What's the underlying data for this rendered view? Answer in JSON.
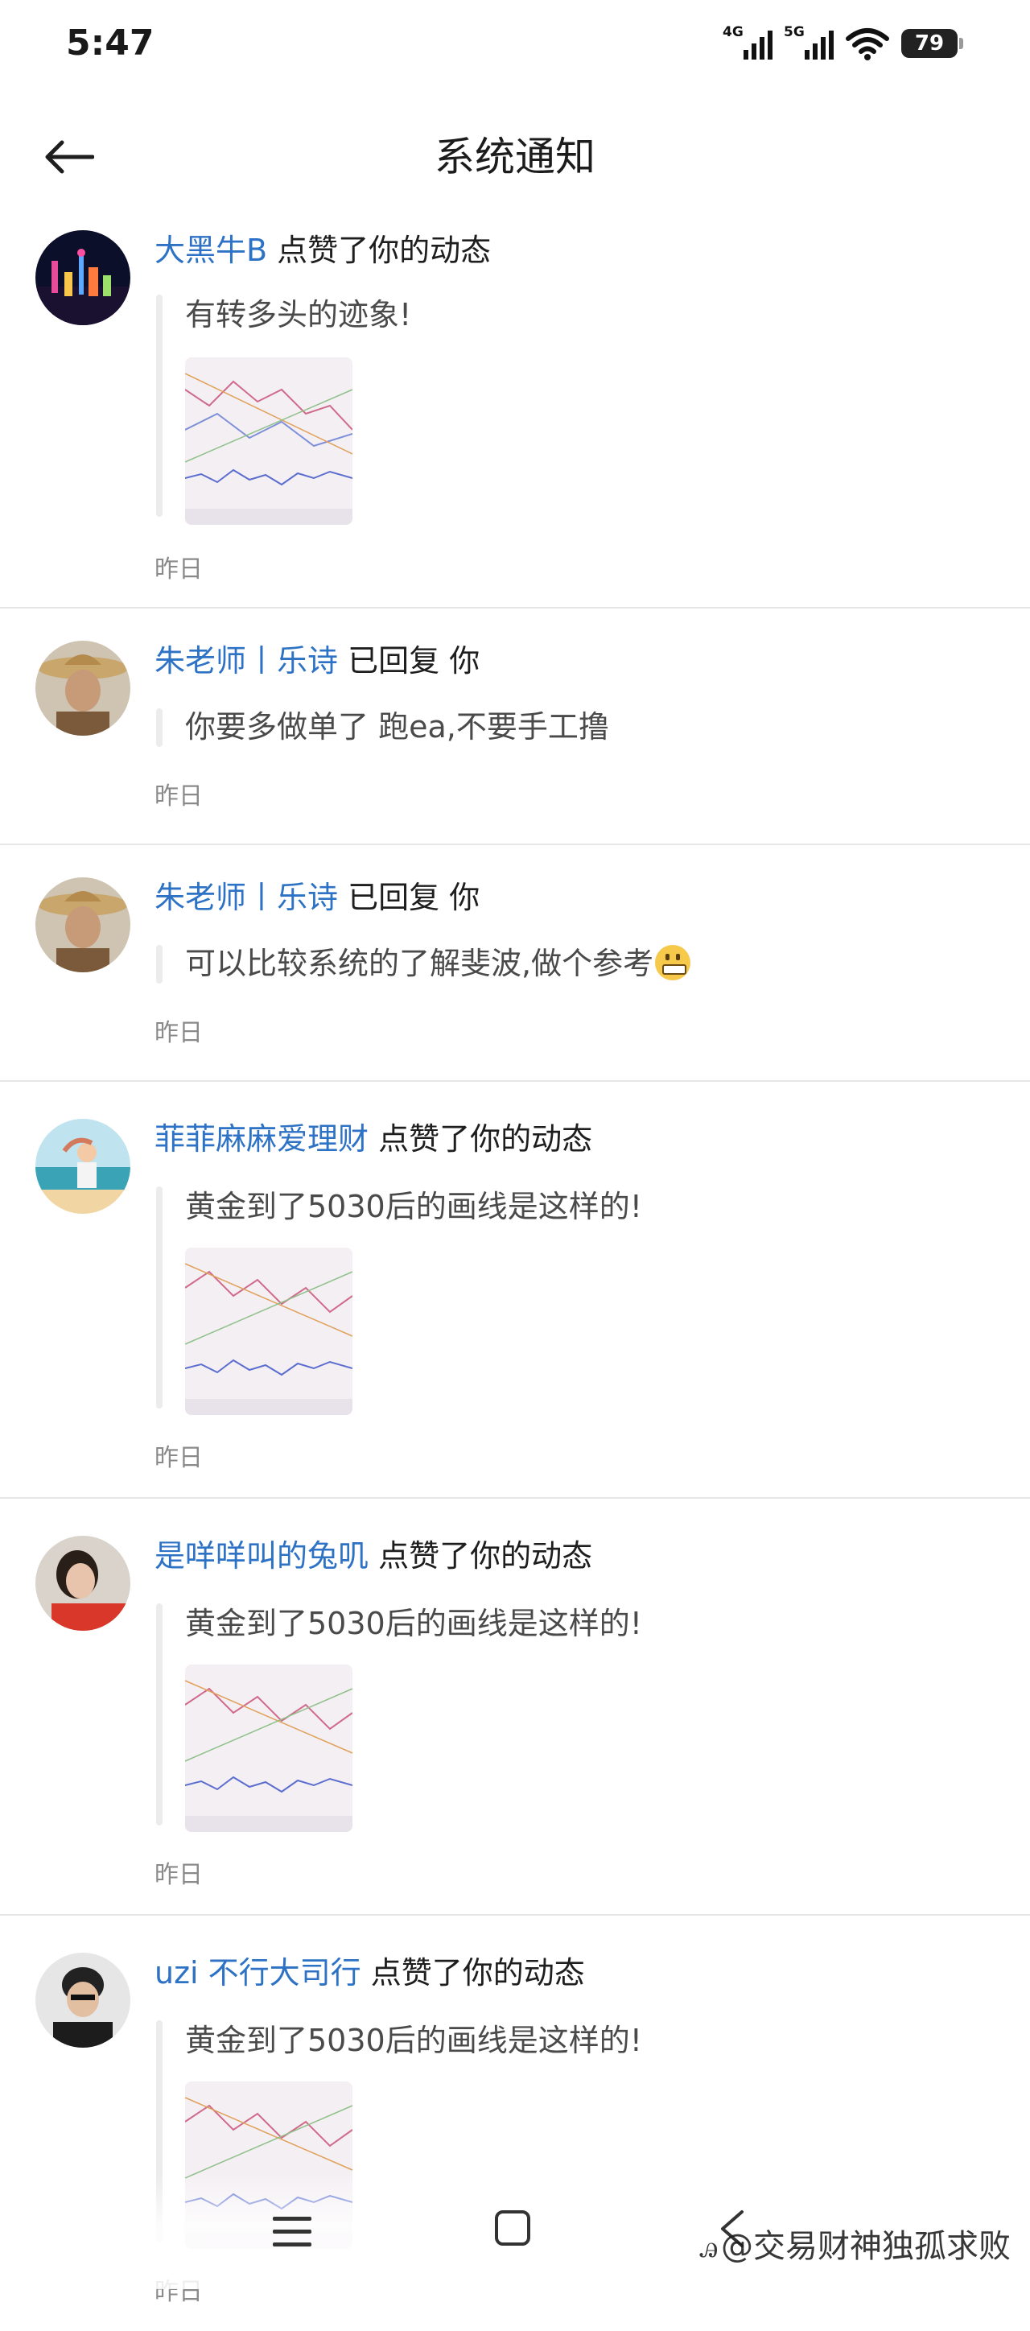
{
  "status_bar": {
    "time": "5:47",
    "net1": "4G",
    "net2": "5G",
    "battery": "79"
  },
  "header": {
    "title": "系统通知"
  },
  "notifications": [
    {
      "user": "大黑牛B",
      "action": "点赞了你的动态",
      "quote": "有转多头的迹象!",
      "has_image": true,
      "time": "昨日"
    },
    {
      "user": "朱老师丨乐诗",
      "action": "已回复 你",
      "quote": "你要多做单了 跑ea,不要手工撸",
      "has_image": false,
      "time": "昨日"
    },
    {
      "user": "朱老师丨乐诗",
      "action": "已回复 你",
      "quote": "可以比较系统的了解斐波,做个参考",
      "has_image": false,
      "time": "昨日"
    },
    {
      "user": "菲菲麻麻爱理财",
      "action": "点赞了你的动态",
      "quote": "黄金到了5030后的画线是这样的!",
      "has_image": true,
      "time": "昨日"
    },
    {
      "user": "是咩咩叫的兔叽",
      "action": "点赞了你的动态",
      "quote": "黄金到了5030后的画线是这样的!",
      "has_image": true,
      "time": "昨日"
    },
    {
      "user": "uzi 不行大司行",
      "action": "点赞了你的动态",
      "quote": "黄金到了5030后的画线是这样的!",
      "has_image": true,
      "time": "昨日"
    }
  ],
  "watermark": {
    "text": "@交易财神独孤求败",
    "logo": "ꭿ"
  },
  "colors": {
    "username": "#2d72c4",
    "divider": "#e6e6e6",
    "time_label": "#8a8a8a"
  }
}
